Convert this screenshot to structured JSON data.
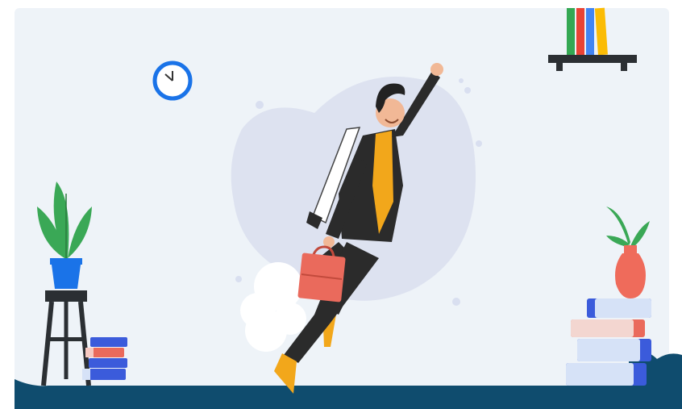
{
  "scene": {
    "description_visible_text": "",
    "colors": {
      "background": "#eef3f8",
      "floor": "#0f4c6e",
      "clock_rim": "#1a73e8",
      "book_blue": "#3b5bdb",
      "book_red": "#ea6a5c",
      "book_light": "#d6e2f7",
      "plant_green": "#3aa856",
      "pot_blue": "#1a73e8",
      "vase_red": "#ef6b5b",
      "suit": "#2b2b2b",
      "shirt": "#f2a71b",
      "briefcase": "#ea6a5c",
      "cloud": "#d9dff0",
      "shelf_books": [
        "#34a853",
        "#ea4335",
        "#4285f4",
        "#fbbc05"
      ]
    },
    "icons": [
      "wall-clock-icon",
      "plant-icon",
      "briefcase-icon",
      "jetpack-icon",
      "book-stack-icon"
    ]
  }
}
